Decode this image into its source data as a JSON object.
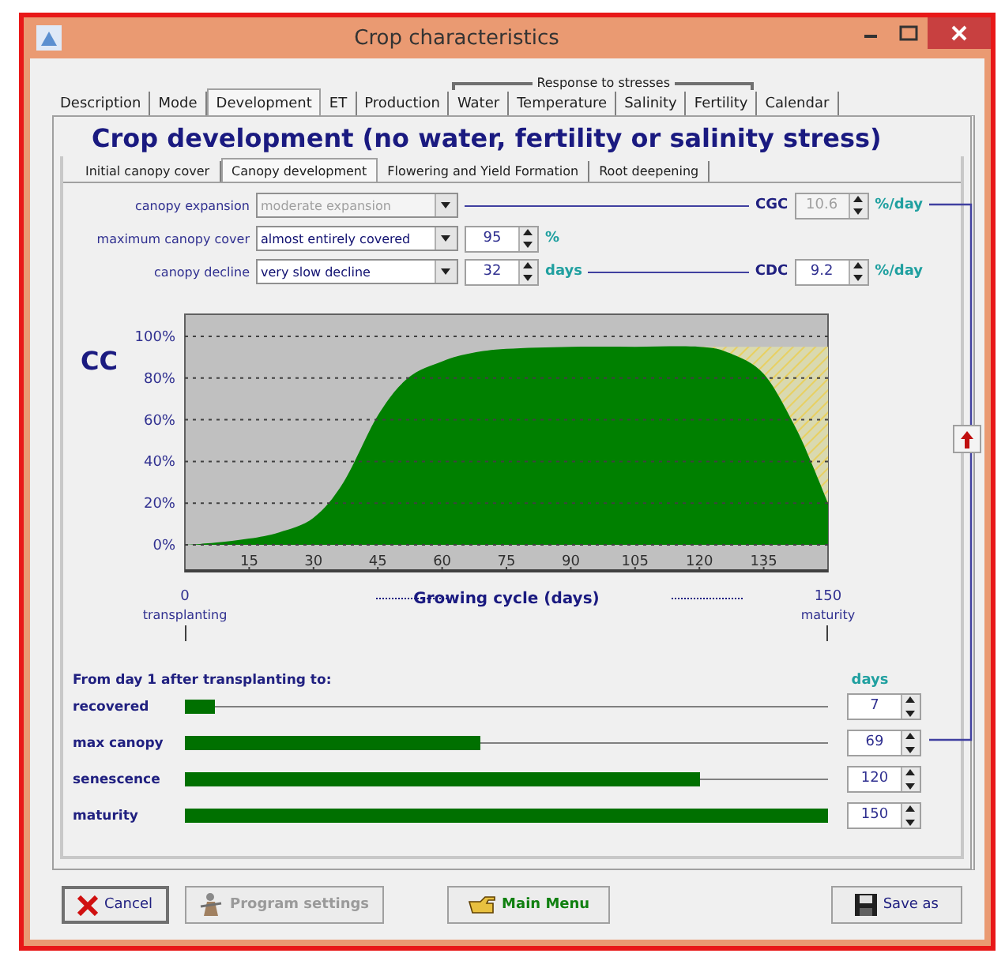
{
  "window": {
    "title": "Crop characteristics"
  },
  "tabs": [
    {
      "kind": "tab",
      "label": "Description",
      "selected": false
    },
    {
      "kind": "tab",
      "label": "Mode",
      "selected": false
    },
    {
      "kind": "tab",
      "label": "Development",
      "selected": true
    },
    {
      "kind": "tab",
      "label": "ET",
      "selected": false
    },
    {
      "kind": "tab",
      "label": "Production",
      "selected": false
    },
    {
      "kind": "group",
      "label": "Response to stresses",
      "tabs": [
        {
          "label": "Water",
          "selected": false
        },
        {
          "label": "Temperature",
          "selected": false
        },
        {
          "label": "Salinity",
          "selected": false
        },
        {
          "label": "Fertility",
          "selected": false
        }
      ]
    },
    {
      "kind": "tab",
      "label": "Calendar",
      "selected": false
    }
  ],
  "heading": "Crop development (no water, fertility or salinity stress)",
  "subtabs": [
    {
      "label": "Initial canopy cover",
      "selected": false
    },
    {
      "label": "Canopy development",
      "selected": true
    },
    {
      "label": "Flowering and Yield Formation",
      "selected": false
    },
    {
      "label": "Root deepening",
      "selected": false
    }
  ],
  "settings": [
    {
      "label": "canopy expansion",
      "value": "moderate expansion",
      "disabled": true,
      "coefficient": {
        "label": "CGC",
        "value": "10.6",
        "unit": "%/day",
        "disabled": true
      }
    },
    {
      "label": "maximum canopy cover",
      "value": "almost entirely covered",
      "disabled": false,
      "number": "95",
      "unit": "%"
    },
    {
      "label": "canopy decline",
      "value": "very slow decline",
      "disabled": false,
      "number": "32",
      "unit": "days",
      "coefficient": {
        "label": "CDC",
        "value": "9.2",
        "unit": "%/day",
        "disabled": false
      }
    }
  ],
  "chart": {
    "axis_start": {
      "value": "0",
      "caption": "transplanting"
    },
    "axis_end": {
      "value": "150",
      "caption": "maturity"
    },
    "chart_data": {
      "type": "area",
      "ylabel": "CC",
      "xlabel": "Growing cycle (days)",
      "x": [
        0,
        7,
        15,
        22,
        30,
        37,
        45,
        52,
        60,
        67,
        75,
        90,
        105,
        120,
        127,
        135,
        142,
        146,
        150
      ],
      "grid": true,
      "series": [
        {
          "color": "#008000",
          "values": [
            0,
            1,
            3,
            6,
            13,
            30,
            62,
            80,
            88,
            92,
            94,
            95,
            95,
            95,
            92,
            82,
            58,
            40,
            20
          ]
        }
      ],
      "xlim": [
        0,
        150
      ],
      "ylim": [
        0,
        100
      ],
      "xticks": [
        15,
        30,
        45,
        60,
        75,
        90,
        105,
        120,
        135
      ],
      "yticks": [
        {
          "value": 0,
          "label": "0%"
        },
        {
          "value": 20,
          "label": "20%"
        },
        {
          "value": 40,
          "label": "40%"
        },
        {
          "value": 60,
          "label": "60%"
        },
        {
          "value": 80,
          "label": "80%"
        },
        {
          "value": 100,
          "label": "100%"
        }
      ]
    }
  },
  "stages": {
    "title": "From day 1 after transplanting to:",
    "unit_header": "days",
    "rows": [
      {
        "label": "recovered",
        "level": 0.047,
        "days": "7"
      },
      {
        "label": "max canopy",
        "level": 0.46,
        "days": "69"
      },
      {
        "label": "senescence",
        "level": 0.8,
        "days": "120"
      },
      {
        "label": "maturity",
        "level": 1,
        "days": "150"
      }
    ]
  },
  "buttons": [
    {
      "kind": "cancel",
      "label": "Cancel",
      "disabled": false
    },
    {
      "kind": "settings",
      "label": "Program settings",
      "disabled": true
    },
    {
      "kind": "menu",
      "label": "Main Menu",
      "disabled": false
    },
    {
      "kind": "save",
      "label": "Save as",
      "disabled": false
    }
  ]
}
